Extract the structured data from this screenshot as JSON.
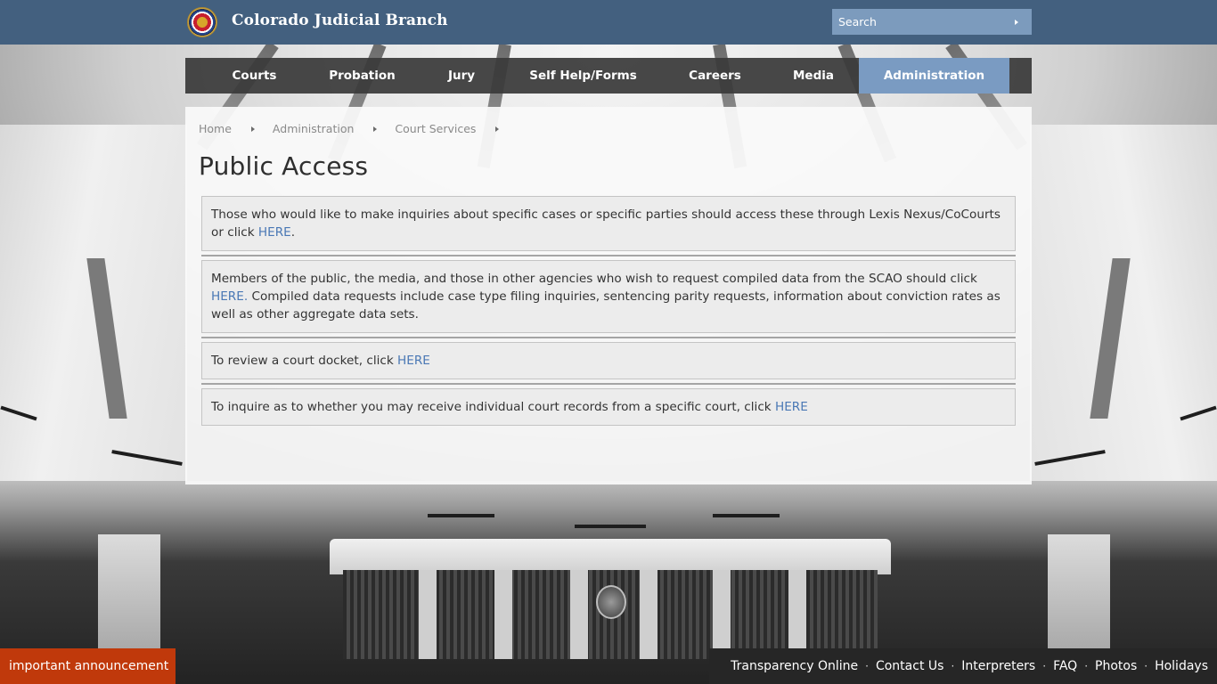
{
  "header": {
    "site_title": "Colorado Judicial Branch",
    "logo_icon": "colorado-courts-seal",
    "search": {
      "placeholder": "Search",
      "value": "",
      "button_icon": "triangle-right"
    }
  },
  "nav": {
    "items": [
      {
        "label": "Courts",
        "active": false
      },
      {
        "label": "Probation",
        "active": false
      },
      {
        "label": "Jury",
        "active": false
      },
      {
        "label": "Self Help/Forms",
        "active": false
      },
      {
        "label": "Careers",
        "active": false
      },
      {
        "label": "Media",
        "active": false
      },
      {
        "label": "Administration",
        "active": true
      }
    ],
    "active_color": "#7a9bc2"
  },
  "breadcrumb": {
    "items": [
      "Home",
      "Administration",
      "Court Services"
    ],
    "separator_icon": "triangle-right"
  },
  "page": {
    "title": "Public Access",
    "blocks": [
      {
        "text": "Those who would like to make inquiries about specific cases or specific parties should access these through Lexis Nexus/CoCourts or click ",
        "link": "HERE",
        "after": "."
      },
      {
        "text": "Members of the public, the media, and those in other agencies who wish to request compiled data from the SCAO should click ",
        "link": "HERE.",
        "after": " Compiled data requests include case type filing inquiries, sentencing parity requests, information about conviction rates as well as other aggregate data sets."
      },
      {
        "text": "To review a court docket, click ",
        "link": "HERE",
        "after": ""
      },
      {
        "text": "To inquire as to whether you may receive individual court records from a specific court, click ",
        "link": "HERE",
        "after": ""
      }
    ],
    "link_color": "#4a78b5"
  },
  "footer": {
    "announcement": "important announcement",
    "announcement_color": "#c0390b",
    "links": [
      "Transparency Online",
      "Contact Us",
      "Interpreters",
      "FAQ",
      "Photos",
      "Holidays"
    ],
    "separator": "·"
  }
}
